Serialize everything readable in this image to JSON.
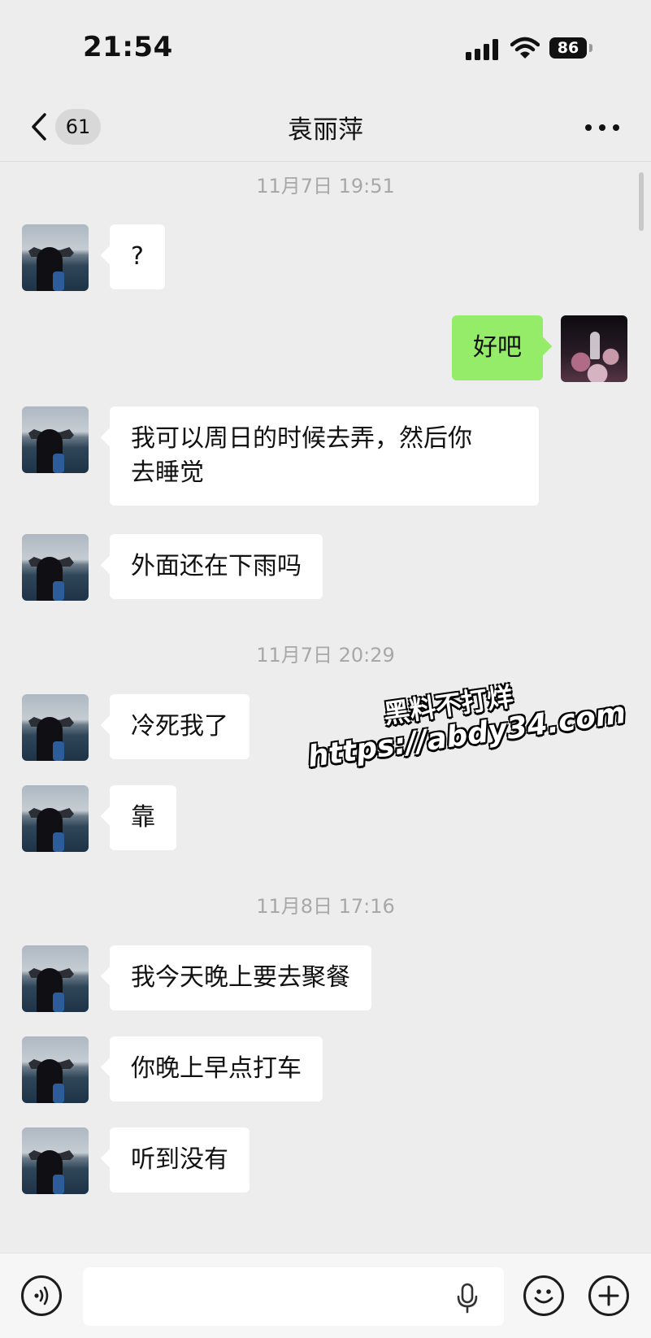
{
  "status_bar": {
    "time": "21:54",
    "battery": "86",
    "icons": [
      "cellular-signal-icon",
      "wifi-icon",
      "battery-icon"
    ]
  },
  "nav": {
    "unread_count": "61",
    "title": "袁丽萍",
    "icons": [
      "back-chevron-icon",
      "more-icon"
    ]
  },
  "timestamps": [
    "11月7日 19:51",
    "11月7日 20:29",
    "11月8日 17:16"
  ],
  "messages": [
    {
      "from": "contact",
      "text": "?"
    },
    {
      "from": "me",
      "text": "好吧"
    },
    {
      "from": "contact",
      "lines": [
        "我可以周日的时候去弄，然后你",
        "去睡觉"
      ]
    },
    {
      "from": "contact",
      "text": "外面还在下雨吗"
    },
    {
      "from": "contact",
      "text": "冷死我了"
    },
    {
      "from": "contact",
      "text": "靠"
    },
    {
      "from": "contact",
      "text": "我今天晚上要去聚餐"
    },
    {
      "from": "contact",
      "text": "你晚上早点打车"
    },
    {
      "from": "contact",
      "text": "听到没有"
    }
  ],
  "watermark": {
    "line1": "黑料不打烊",
    "line2": "https://abdy34.com"
  },
  "input_bar": {
    "input_value": "",
    "icons": [
      "voice-toggle-icon",
      "microphone-icon",
      "emoji-icon",
      "plus-icon"
    ]
  },
  "colors": {
    "background": "#ededed",
    "incoming_bubble": "#ffffff",
    "outgoing_bubble": "#95ec69",
    "timestamp_text": "#a8a8a8"
  }
}
